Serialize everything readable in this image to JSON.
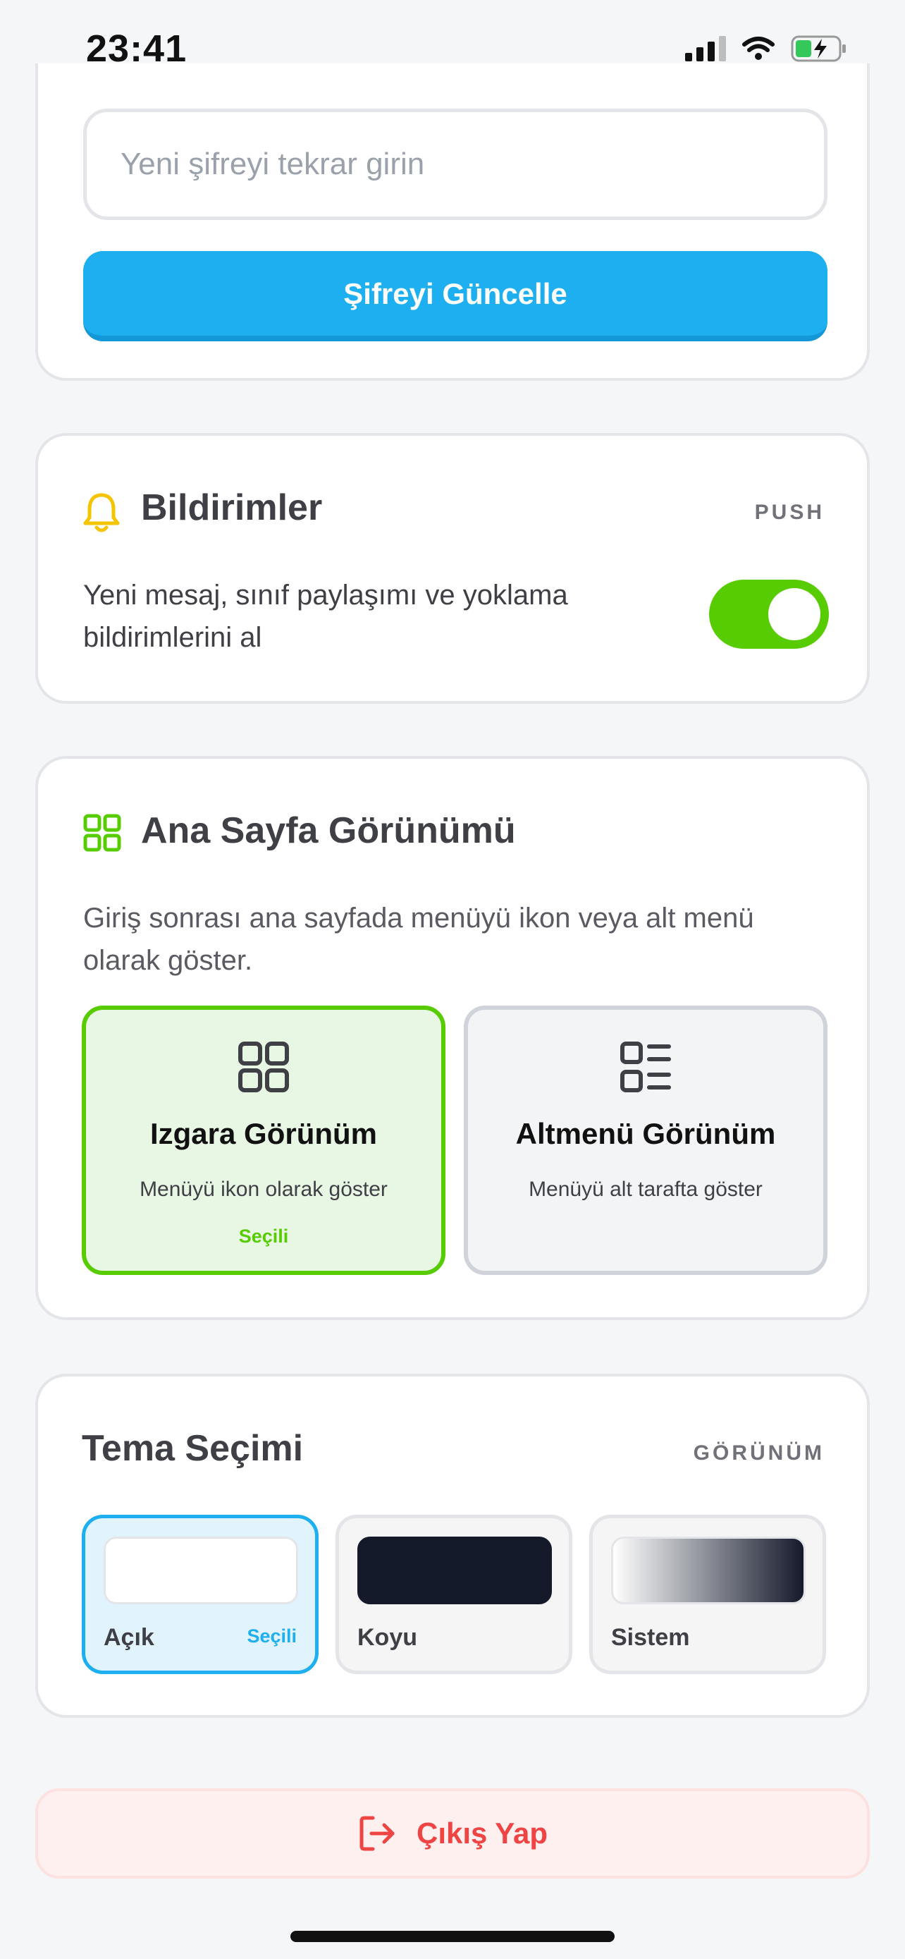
{
  "status_bar": {
    "time": "23:41"
  },
  "password": {
    "confirm_placeholder": "Yeni şifreyi tekrar girin",
    "update_button": "Şifreyi Güncelle"
  },
  "notifications": {
    "title": "Bildirimler",
    "tag": "PUSH",
    "description": "Yeni mesaj, sınıf paylaşımı ve yoklama bildirimlerini al",
    "enabled": true
  },
  "home_view": {
    "title": "Ana Sayfa Görünümü",
    "description": "Giriş sonrası ana sayfada menüyü ikon veya alt menü olarak göster.",
    "options": [
      {
        "title": "Izgara Görünüm",
        "subtitle": "Menüyü ikon olarak göster",
        "selected_label": "Seçili",
        "selected": true,
        "icon": "grid-icon"
      },
      {
        "title": "Altmenü Görünüm",
        "subtitle": "Menüyü alt tarafta göster",
        "selected_label": "",
        "selected": false,
        "icon": "list-icon"
      }
    ]
  },
  "theme": {
    "title": "Tema Seçimi",
    "tag": "GÖRÜNÜM",
    "options": [
      {
        "label": "Açık",
        "selected_label": "Seçili",
        "selected": true
      },
      {
        "label": "Koyu",
        "selected_label": "",
        "selected": false
      },
      {
        "label": "Sistem",
        "selected_label": "",
        "selected": false
      }
    ]
  },
  "logout": {
    "label": "Çıkış Yap"
  },
  "colors": {
    "accent_blue": "#1eaff0",
    "accent_green": "#58cc02",
    "danger": "#ef4444",
    "bell": "#f5c400"
  }
}
